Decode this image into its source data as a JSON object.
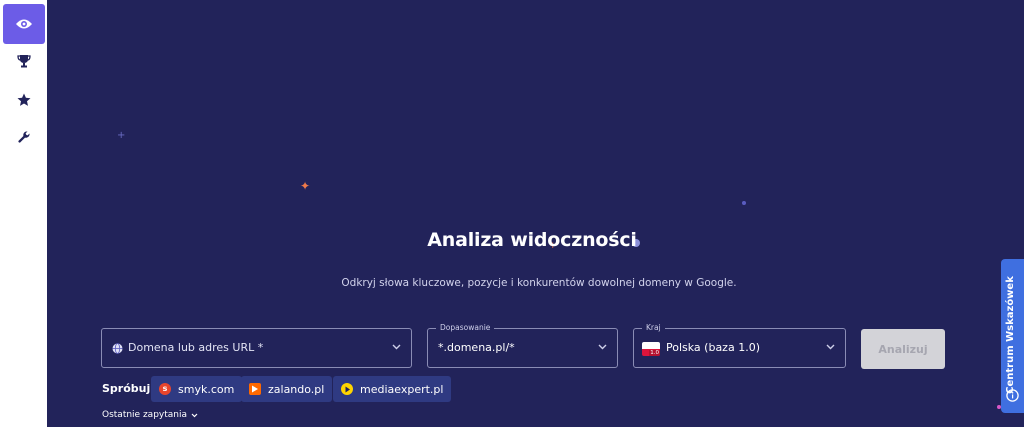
{
  "sidebar": {
    "items": [
      {
        "icon": "eye-icon",
        "active": true
      },
      {
        "icon": "trophy-icon",
        "active": false
      },
      {
        "icon": "star-icon",
        "active": false
      },
      {
        "icon": "wrench-icon",
        "active": false
      }
    ]
  },
  "hero": {
    "title": "Analiza widoczności",
    "subtitle": "Odkryj słowa kluczowe, pozycje i konkurentów dowolnej domeny w Google."
  },
  "form": {
    "domain": {
      "placeholder": "Domena lub adres URL *"
    },
    "match": {
      "label": "Dopasowanie",
      "value": "*.domena.pl/*"
    },
    "country": {
      "label": "Kraj",
      "value": "Polska (baza 1.0)",
      "flag_badge": "1.0"
    },
    "analyze_label": "Analizuj"
  },
  "suggestions": {
    "label": "Spróbuj:",
    "chips": [
      {
        "label": "smyk.com",
        "icon": "smyk-logo-icon"
      },
      {
        "label": "zalando.pl",
        "icon": "zalando-logo-icon"
      },
      {
        "label": "mediaexpert.pl",
        "icon": "mediaexpert-logo-icon"
      }
    ]
  },
  "recent": {
    "label": "Ostatnie zapytania"
  },
  "help_center": {
    "label": "Centrum Wskazówek"
  },
  "colors": {
    "background": "#22235a",
    "accent": "#6c5ce7",
    "chip": "#2f3a82",
    "help": "#3f6fe0"
  }
}
